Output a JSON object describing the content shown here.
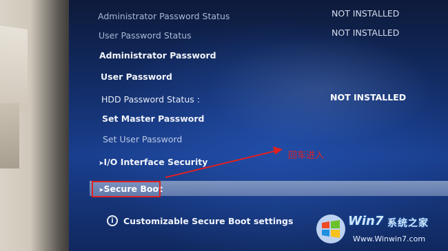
{
  "menu": {
    "admin_pw_status_label": "Administrator Password Status",
    "admin_pw_status_value": "NOT INSTALLED",
    "user_pw_status_label": "User Password Status",
    "user_pw_status_value": "NOT INSTALLED",
    "admin_pw_label": "Administrator Password",
    "user_pw_label": "User Password",
    "hdd_pw_status_label": "HDD Password Status :",
    "hdd_pw_status_value": "NOT INSTALLED",
    "set_master_pw_label": "Set Master Password",
    "set_user_pw_label": "Set User Password",
    "io_security_label": "I/O Interface Security",
    "secure_boot_label": "Secure Boot"
  },
  "help": {
    "text": "Customizable Secure Boot settings"
  },
  "annotation": {
    "text": "回车进入"
  },
  "watermark": {
    "brand": "Win7",
    "brand_suffix": "系统之家",
    "url": "Www.Winwin7.com"
  },
  "colors": {
    "bios_background": "#1a3f8f",
    "highlight": "#8fa3c8",
    "annotation_red": "#e02020"
  }
}
